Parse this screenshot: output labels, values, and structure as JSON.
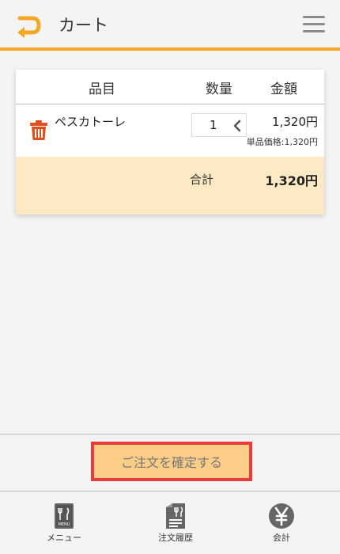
{
  "header": {
    "title": "カート",
    "back_icon": "back-arrow-icon",
    "menu_icon": "hamburger-menu-icon",
    "accent_color": "#f5a623"
  },
  "cart": {
    "columns": [
      "品目",
      "数量",
      "金額"
    ],
    "items": [
      {
        "name": "ペスカトーレ",
        "quantity": "1",
        "price": "1,320円",
        "unit_price": "単品価格:1,320円"
      }
    ],
    "total_label": "合計",
    "total_value": "1,320円"
  },
  "confirm": {
    "label": "ご注文を確定する"
  },
  "tabs": [
    {
      "label": "メニュー",
      "icon": "menu-book-icon",
      "badge": "MENU"
    },
    {
      "label": "注文履歴",
      "icon": "order-history-icon"
    },
    {
      "label": "会計",
      "icon": "yen-icon"
    }
  ]
}
